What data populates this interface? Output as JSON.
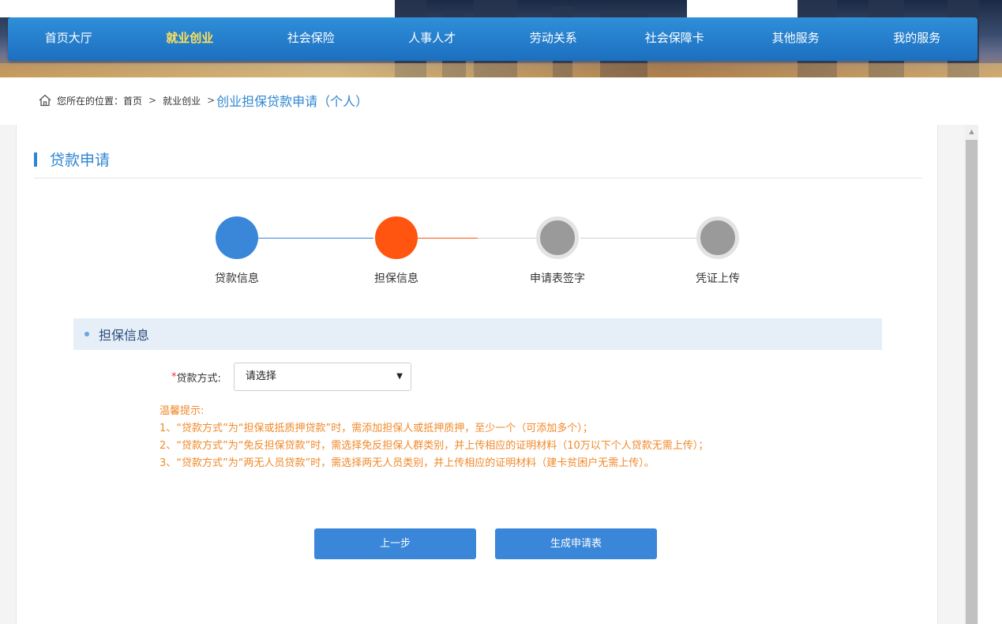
{
  "nav": {
    "items": [
      "首页大厅",
      "就业创业",
      "社会保险",
      "人事人才",
      "劳动关系",
      "社会保障卡",
      "其他服务",
      "我的服务"
    ],
    "active_index": 1
  },
  "breadcrumb": {
    "prefix": "您所在的位置：",
    "home": "首页",
    "sep": ">",
    "level2": "就业创业",
    "current": "创业担保贷款申请（个人）"
  },
  "section": {
    "title": "贷款申请"
  },
  "steps": [
    {
      "label": "贷款信息",
      "state": "done"
    },
    {
      "label": "担保信息",
      "state": "current"
    },
    {
      "label": "申请表签字",
      "state": "todo"
    },
    {
      "label": "凭证上传",
      "state": "todo"
    }
  ],
  "guarantee": {
    "title": "担保信息",
    "required_mark": "*",
    "loan_method_label": "贷款方式:",
    "loan_method_value": "请选择"
  },
  "tips": {
    "title": "温馨提示:",
    "lines": [
      "1、“贷款方式”为“担保或抵质押贷款”时，需添加担保人或抵押质押，至少一个（可添加多个）；",
      "2、“贷款方式”为“免反担保贷款”时，需选择免反担保人群类别，并上传相应的证明材料（10万以下个人贷款无需上传）；",
      "3、“贷款方式”为“两无人员贷款”时，需选择两无人员类别，并上传相应的证明材料（建卡贫困户无需上传）。"
    ]
  },
  "buttons": {
    "prev": "上一步",
    "generate": "生成申请表"
  },
  "colors": {
    "primary": "#3a86d9",
    "current_step": "#ff5510",
    "tips": "#f0892a",
    "nav_active": "#ffe25a"
  }
}
